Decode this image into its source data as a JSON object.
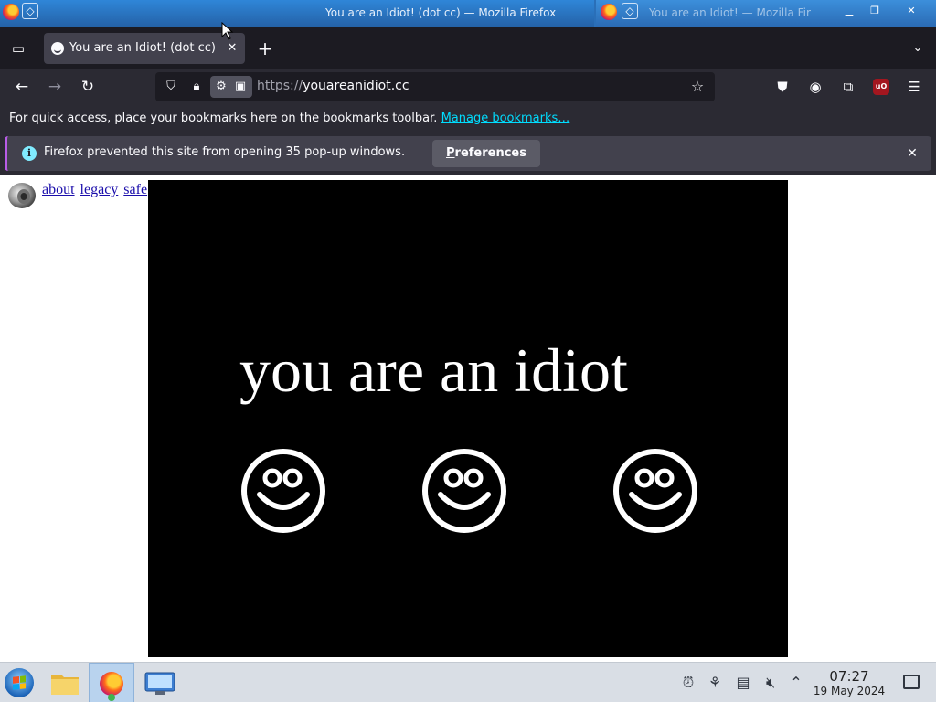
{
  "window_manager": {
    "active_title": "You are an Idiot! (dot cc) — Mozilla Firefox",
    "ghost_title": "You are an Idiot! — Mozilla Fir"
  },
  "tab": {
    "title": "You are an Idiot! (dot cc)",
    "close_glyph": "✕",
    "new_tab_glyph": "+",
    "list_glyph": "⌄"
  },
  "navbar": {
    "back_glyph": "←",
    "forward_glyph": "→",
    "reload_glyph": "↻",
    "url_scheme": "https://",
    "url_host": "youareanidiot.cc"
  },
  "bookmarks_bar": {
    "text": "For quick access, place your bookmarks here on the bookmarks toolbar. ",
    "link": "Manage bookmarks…"
  },
  "notification": {
    "text": "Firefox prevented this site from opening 35 pop-up windows.",
    "button_accesskey": "P",
    "button_rest": "references",
    "info_glyph": "i",
    "close_glyph": "✕"
  },
  "page": {
    "links": [
      "about",
      "legacy",
      "safe"
    ],
    "headline": "you are an idiot"
  },
  "taskbar": {
    "clock_time": "07:27",
    "clock_date": "19 May 2024"
  },
  "colors": {
    "chrome_dark": "#1c1b22",
    "chrome": "#2b2a33",
    "accent_link": "#00ddff",
    "stage_bg": "#000000",
    "stage_fg": "#ffffff"
  }
}
